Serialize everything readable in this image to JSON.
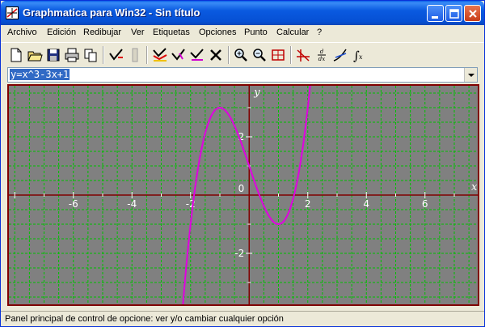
{
  "window": {
    "title": "Graphmatica para Win32 - Sin título"
  },
  "menu": [
    "Archivo",
    "Edición",
    "Redibujar",
    "Ver",
    "Etiquetas",
    "Opciones",
    "Punto",
    "Calcular",
    "?"
  ],
  "toolbar": {
    "icons": [
      "new-file-icon",
      "open-folder-icon",
      "save-disk-icon",
      "print-icon",
      "copy-icon",
      "draw-graph-icon",
      "grid-pencil-icon",
      "multi-graph-icon",
      "redraw-all-icon",
      "edit-graph-icon",
      "delete-graph-icon",
      "zoom-in-icon",
      "zoom-out-icon",
      "zoom-box-icon",
      "crosshair-icon",
      "derivative-icon",
      "tangent-icon",
      "integral-icon"
    ]
  },
  "equation": {
    "value": "y=x^3-3x+1"
  },
  "graph": {
    "x_axis_label": "x",
    "y_axis_label": "y",
    "background": "#808080",
    "grid_color": "#00c000",
    "axis_color": "#800000",
    "curve_color": "#e000e0"
  },
  "chart_data": {
    "type": "line",
    "equation": "y=x^3-3x+1",
    "xlim": [
      -8.2,
      7.8
    ],
    "ylim": [
      -3.75,
      3.75
    ],
    "x_ticks": [
      -6,
      -4,
      -2,
      0,
      2,
      4,
      6
    ],
    "y_ticks": [
      -2,
      0,
      2
    ],
    "x_tick_labels": [
      "-6",
      "-4",
      "-2",
      "0",
      "2",
      "4",
      "6"
    ],
    "y_tick_labels": [
      "-2",
      "0",
      "2"
    ],
    "xlabel": "x",
    "ylabel": "y",
    "grid": true
  },
  "status": {
    "text": "Panel principal de control de opcione: ver y/o cambiar cualquier opción"
  }
}
